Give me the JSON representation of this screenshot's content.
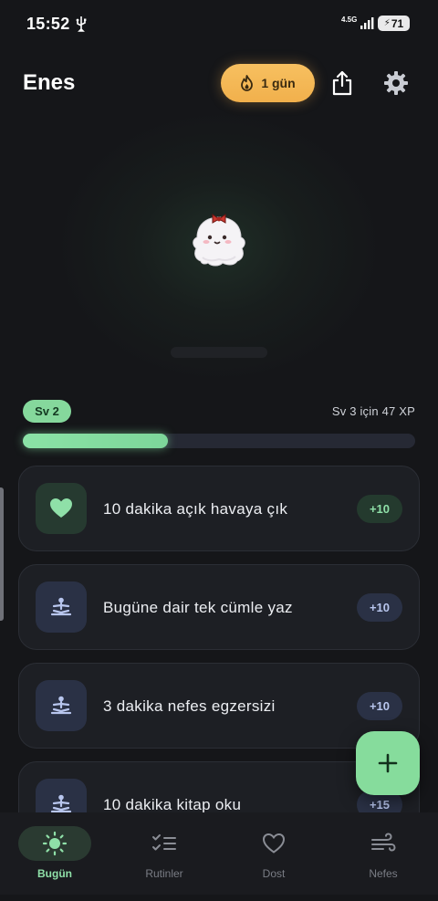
{
  "status_bar": {
    "time": "15:52",
    "network": "4.5G",
    "battery": "71",
    "usb_icon": "usb-icon",
    "signal_icon": "signal-icon"
  },
  "header": {
    "user_name": "Enes",
    "streak_label": "1 gün",
    "streak_icon": "flame-icon",
    "share_icon": "share-icon",
    "settings_icon": "gear-icon"
  },
  "level": {
    "badge": "Sv 2",
    "xp_to_next": "Sv 3 için 47 XP",
    "progress": 0.37
  },
  "tasks": [
    {
      "label": "10 dakika açık havaya çık",
      "xp": "+10",
      "icon": "heart-icon",
      "theme": "green"
    },
    {
      "label": "Bugüne dair tek cümle yaz",
      "xp": "+10",
      "icon": "meditation-icon",
      "theme": "blue"
    },
    {
      "label": "3 dakika nefes egzersizi",
      "xp": "+10",
      "icon": "meditation-icon",
      "theme": "blue"
    },
    {
      "label": "10 dakika kitap oku",
      "xp": "+15",
      "icon": "meditation-icon",
      "theme": "blue"
    }
  ],
  "fab": {
    "icon": "plus-icon"
  },
  "nav": [
    {
      "label": "Bugün",
      "icon": "sun-icon",
      "active": true
    },
    {
      "label": "Rutinler",
      "icon": "checklist-icon",
      "active": false
    },
    {
      "label": "Dost",
      "icon": "heart-outline-icon",
      "active": false
    },
    {
      "label": "Nefes",
      "icon": "wind-icon",
      "active": false
    }
  ],
  "colors": {
    "background": "#151619",
    "accent_green": "#86dc9c",
    "streak_orange": "#f1b04c",
    "card": "#1d1f24"
  }
}
